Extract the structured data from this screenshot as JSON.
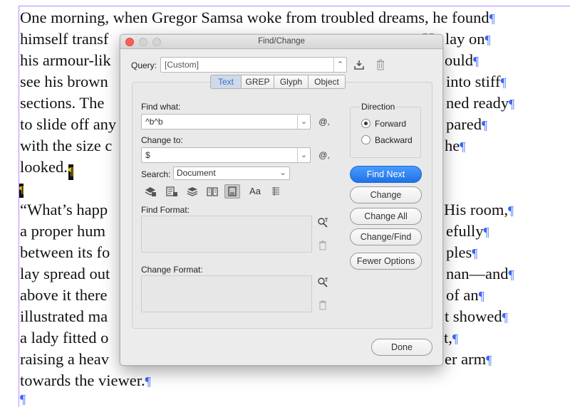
{
  "document": {
    "line1": "One morning, when Gregor Samsa woke from troubled dreams, he found",
    "pilcrow": "¶",
    "left_fragments": [
      "himself transf",
      "his armour-lik",
      "see his brown",
      "sections. The",
      "to slide off any",
      "with the size c",
      "looked.",
      "",
      "“What’s happ",
      "a proper hum",
      "between its fo",
      "lay spread out",
      "above it there",
      "illustrated ma",
      "a lady fitted o",
      "raising a heav",
      "towards the viewer."
    ],
    "right_fragments": [
      {
        "text": "He lay on",
        "row": 1
      },
      {
        "text": "ould",
        "row": 2
      },
      {
        "text": "into stiff",
        "row": 3
      },
      {
        "text": "ned ready",
        "row": 4
      },
      {
        "text": "pared",
        "row": 5
      },
      {
        "text": "he",
        "row": 6
      },
      {
        "text": "His room,",
        "row": 9
      },
      {
        "text": "efully",
        "row": 10
      },
      {
        "text": "ples",
        "row": 11
      },
      {
        "text": "nan—and",
        "row": 12
      },
      {
        "text": "of an",
        "row": 13
      },
      {
        "text": "t showed",
        "row": 14
      },
      {
        "text": "t,",
        "row": 15
      },
      {
        "text": "er arm",
        "row": 16
      }
    ]
  },
  "dialog": {
    "title": "Find/Change",
    "query_label": "Query:",
    "query_value": "[Custom]",
    "tabs": [
      "Text",
      "GREP",
      "Glyph",
      "Object"
    ],
    "active_tab": "Text",
    "find_what_label": "Find what:",
    "find_what_value": "^b^b",
    "change_to_label": "Change to:",
    "change_to_value": "$",
    "special_char_symbol": "@,",
    "search_label": "Search:",
    "search_value": "Document",
    "find_format_label": "Find Format:",
    "change_format_label": "Change Format:",
    "direction_label": "Direction",
    "direction_options": [
      "Forward",
      "Backward"
    ],
    "direction_selected": "Forward",
    "buttons": {
      "find_next": "Find Next",
      "change": "Change",
      "change_all": "Change All",
      "change_find": "Change/Find",
      "fewer_options": "Fewer Options",
      "done": "Done"
    },
    "case_icon_text": "Aa"
  },
  "colors": {
    "primary_button": "#2a7ff0",
    "active_tab_text": "#3a74c4",
    "pilcrow": "#3a66ff",
    "frame_edge": "#b48cff"
  }
}
